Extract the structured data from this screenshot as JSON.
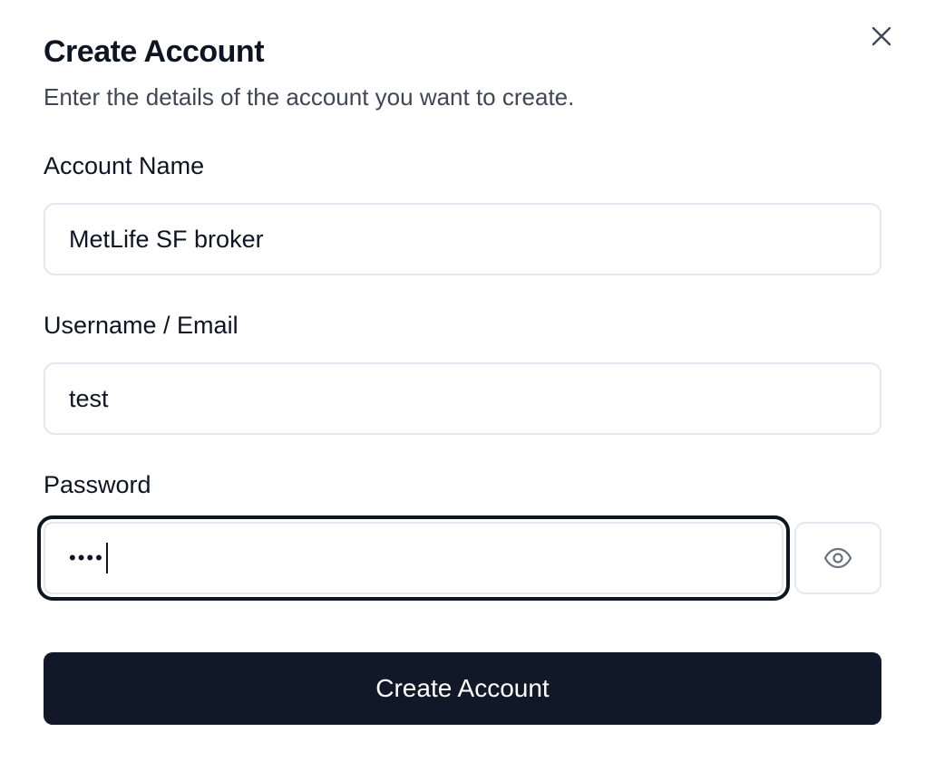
{
  "dialog": {
    "title": "Create Account",
    "subtitle": "Enter the details of the account you want to create.",
    "close_icon": "close-icon"
  },
  "fields": {
    "account_name": {
      "label": "Account Name",
      "value": "MetLife SF broker"
    },
    "username": {
      "label": "Username / Email",
      "value": "test"
    },
    "password": {
      "label": "Password",
      "masked_value": "••••",
      "toggle_icon": "eye-icon"
    }
  },
  "actions": {
    "submit_label": "Create Account"
  },
  "colors": {
    "primary": "#111827",
    "border": "#e4e6f0",
    "text": "#0f1423",
    "muted": "#3f4654"
  }
}
